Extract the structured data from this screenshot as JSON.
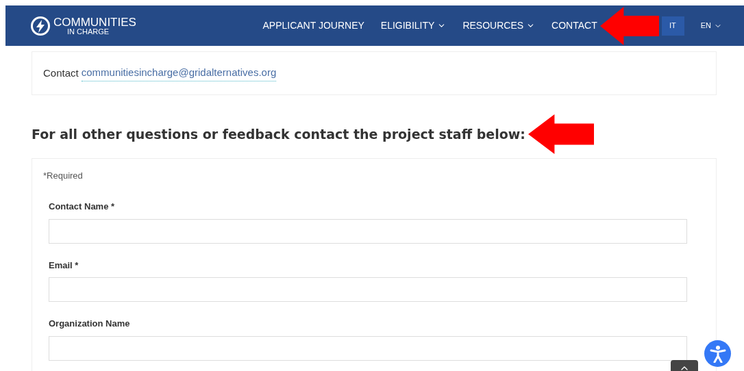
{
  "logo": {
    "title": "COMMUNITIES",
    "subtitle": "IN CHARGE"
  },
  "nav": [
    {
      "label": "APPLICANT JOURNEY",
      "dropdown": false
    },
    {
      "label": "ELIGIBILITY",
      "dropdown": true
    },
    {
      "label": "RESOURCES",
      "dropdown": true
    },
    {
      "label": "CONTACT",
      "dropdown": false
    }
  ],
  "nav_button": "IT",
  "language": "EN",
  "contact_card": {
    "text": "Contact",
    "email": "communitiesincharge@gridalternatives.org"
  },
  "heading": "For all other questions or feedback contact the project staff below:",
  "form": {
    "required_note": "*Required",
    "fields": [
      {
        "label": "Contact Name *"
      },
      {
        "label": "Email *"
      },
      {
        "label": "Organization Name"
      }
    ]
  }
}
